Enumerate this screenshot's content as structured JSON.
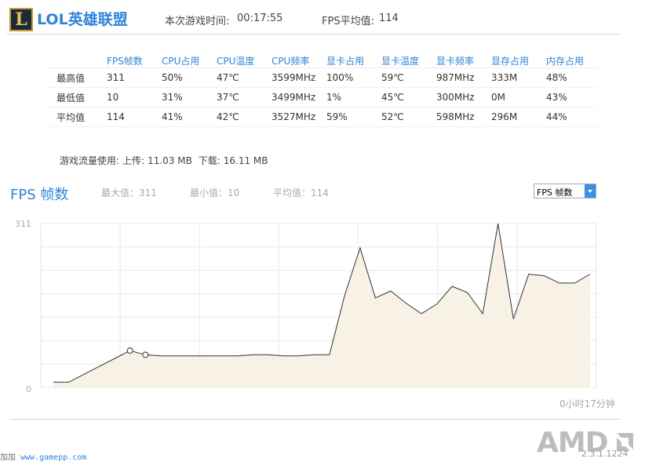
{
  "header": {
    "logo_letter": "L",
    "app_title": "LOL英雄联盟",
    "game_time_label": "本次游戏时间:",
    "game_time_value": "00:17:55",
    "fps_avg_label": "FPS平均值:",
    "fps_avg_value": "114"
  },
  "stats_table": {
    "columns": [
      "FPS帧数",
      "CPU占用",
      "CPU温度",
      "CPU频率",
      "显卡占用",
      "显卡温度",
      "显卡频率",
      "显存占用",
      "内存占用"
    ],
    "rows": [
      {
        "label": "最高值",
        "values": [
          "311",
          "50%",
          "47℃",
          "3599MHz",
          "100%",
          "59℃",
          "987MHz",
          "333M",
          "48%"
        ]
      },
      {
        "label": "最低值",
        "values": [
          "10",
          "31%",
          "37℃",
          "3499MHz",
          "1%",
          "45℃",
          "300MHz",
          "0M",
          "43%"
        ]
      },
      {
        "label": "平均值",
        "values": [
          "114",
          "41%",
          "42℃",
          "3527MHz",
          "59%",
          "52℃",
          "598MHz",
          "296M",
          "44%"
        ]
      }
    ]
  },
  "traffic": {
    "label": "游戏流量使用:",
    "upload_label": "上传:",
    "upload_value": "11.03 MB",
    "download_label": "下载:",
    "download_value": "16.11 MB"
  },
  "fps_panel": {
    "title": "FPS 帧数",
    "max_label": "最大值：311",
    "min_label": "最小值：10",
    "avg_label": "平均值：114",
    "selector_value": "FPS 帧数",
    "time_label": "0小时17分钟"
  },
  "chart_data": {
    "type": "area",
    "ylim": [
      0,
      311
    ],
    "y_ticks": [
      "311",
      "0"
    ],
    "grid": true,
    "x": [
      0,
      1,
      2,
      3,
      4,
      5,
      6,
      7,
      8,
      9,
      10,
      11,
      12,
      13,
      14,
      15,
      16,
      17,
      18,
      19,
      20,
      21,
      22,
      23,
      24,
      25,
      26,
      27,
      28,
      29,
      30,
      31,
      32,
      33,
      34,
      35
    ],
    "values": [
      10,
      10,
      25,
      40,
      55,
      70,
      62,
      60,
      60,
      60,
      60,
      60,
      60,
      62,
      62,
      60,
      60,
      62,
      62,
      175,
      265,
      170,
      183,
      160,
      140,
      158,
      192,
      180,
      140,
      311,
      130,
      215,
      212,
      198,
      198,
      215
    ],
    "markers": [
      5,
      6
    ],
    "fill_color": "#f7f1e6",
    "line_color": "#333333"
  },
  "footer": {
    "site_prefix": "加加",
    "site_url": "www.gamepp.com",
    "brand": "AMD",
    "version": "2.3.1.1224"
  }
}
